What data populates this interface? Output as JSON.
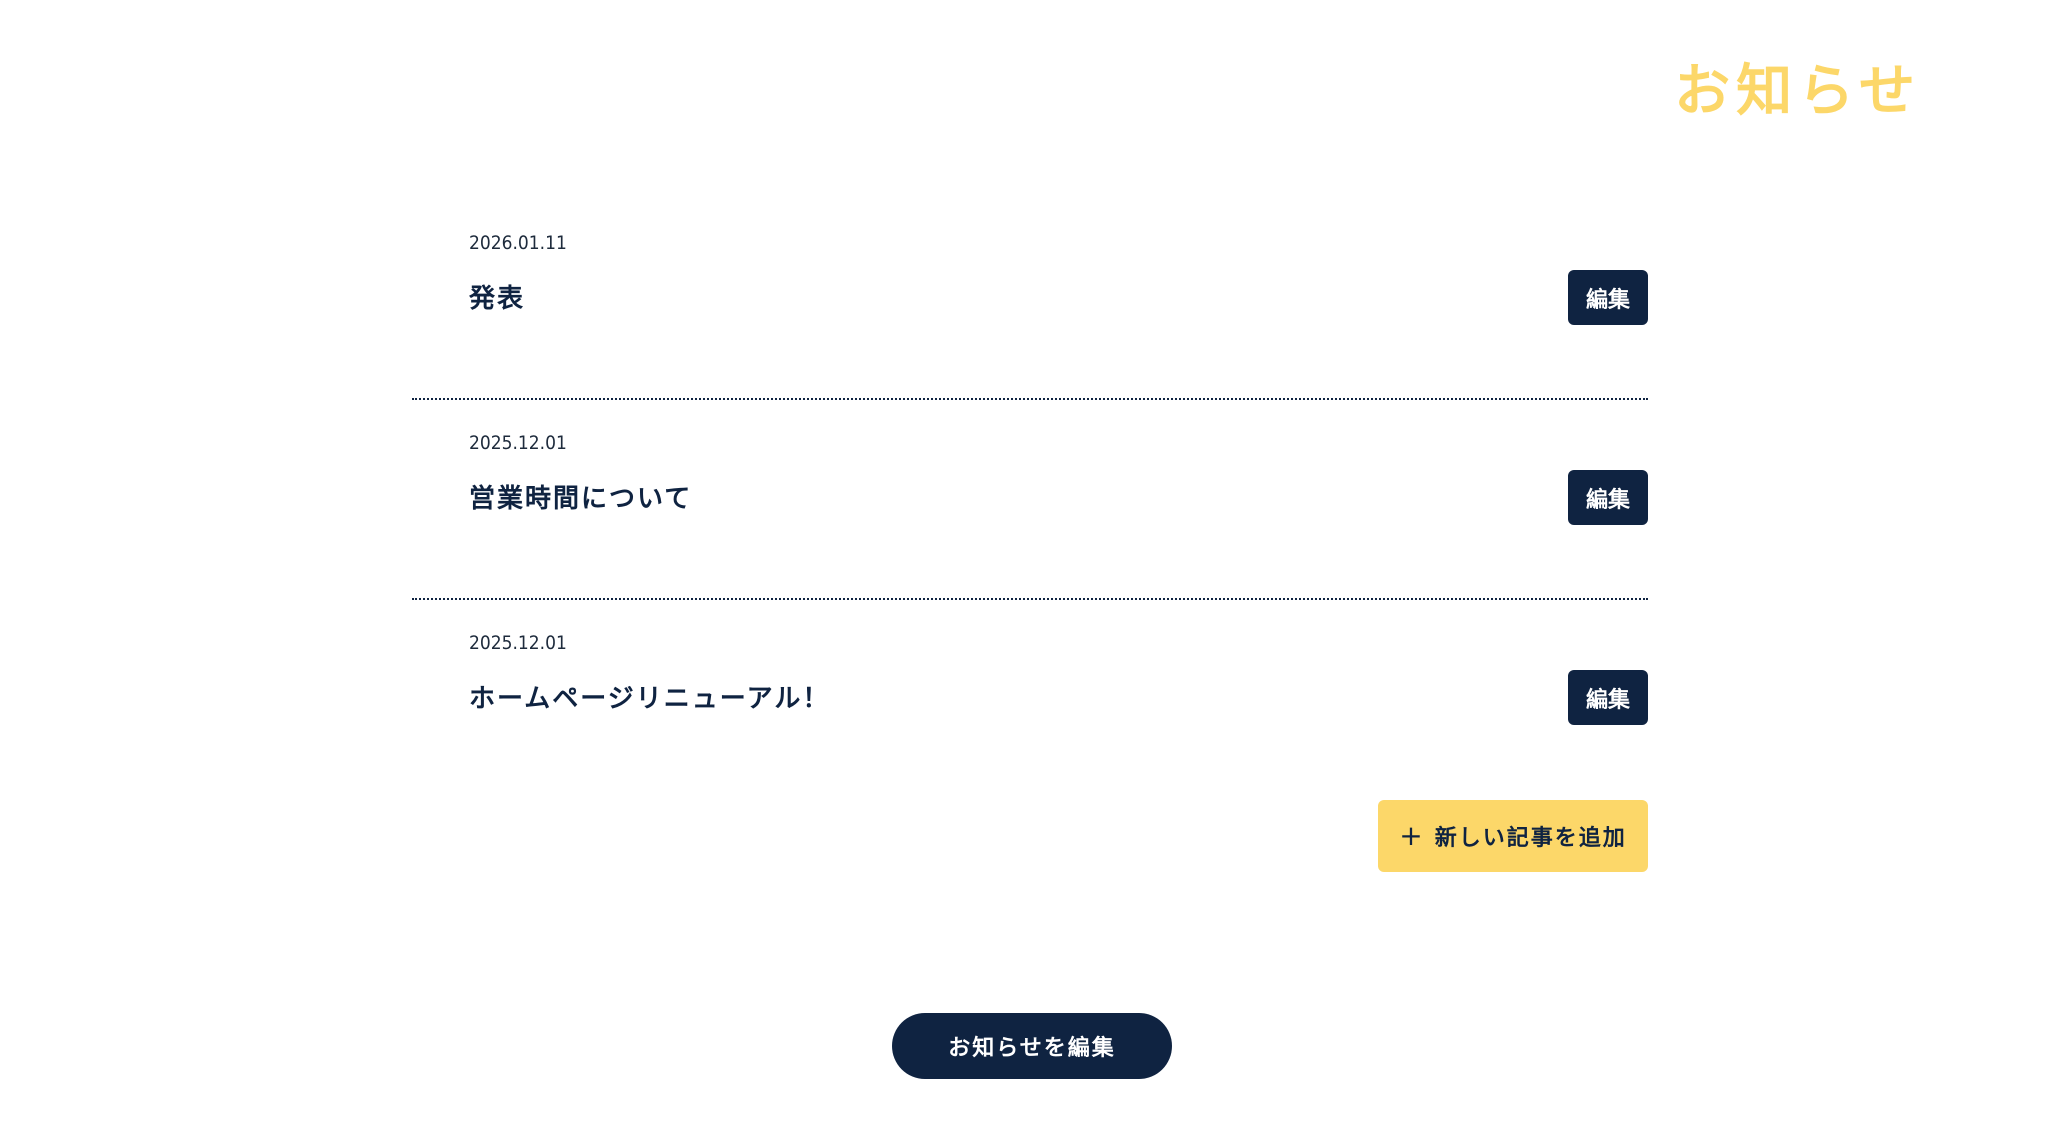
{
  "header": {
    "title": "お知らせ"
  },
  "news": {
    "items": [
      {
        "date": "2026.01.11",
        "title": "発表",
        "edit_label": "編集"
      },
      {
        "date": "2025.12.01",
        "title": "営業時間について",
        "edit_label": "編集"
      },
      {
        "date": "2025.12.01",
        "title": "ホームページリニューアル！",
        "edit_label": "編集"
      }
    ]
  },
  "actions": {
    "add_icon": "plus-icon",
    "add_label": "新しい記事を追加",
    "edit_news_label": "お知らせを編集"
  },
  "colors": {
    "accent_yellow": "#fcd769",
    "navy": "#0f2341",
    "background": "#ffffff"
  }
}
